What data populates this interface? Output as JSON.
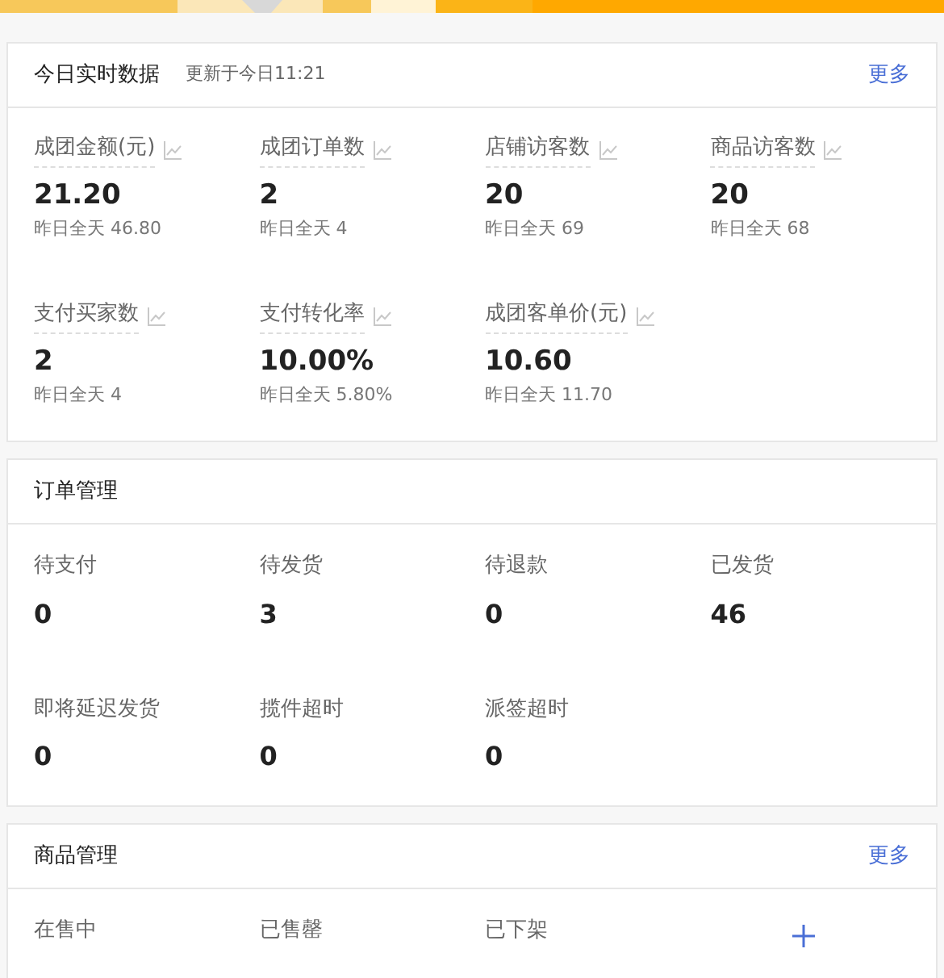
{
  "realtime": {
    "title": "今日实时数据",
    "updated": "更新于今日11:21",
    "more": "更多",
    "metrics": [
      {
        "label": "成团金额(元)",
        "value": "21.20",
        "yesterday": "昨日全天 46.80"
      },
      {
        "label": "成团订单数",
        "value": "2",
        "yesterday": "昨日全天 4"
      },
      {
        "label": "店铺访客数",
        "value": "20",
        "yesterday": "昨日全天 69"
      },
      {
        "label": "商品访客数",
        "value": "20",
        "yesterday": "昨日全天 68"
      },
      {
        "label": "支付买家数",
        "value": "2",
        "yesterday": "昨日全天 4"
      },
      {
        "label": "支付转化率",
        "value": "10.00%",
        "yesterday": "昨日全天 5.80%"
      },
      {
        "label": "成团客单价(元)",
        "value": "10.60",
        "yesterday": "昨日全天 11.70"
      }
    ]
  },
  "orders": {
    "title": "订单管理",
    "items": [
      {
        "label": "待支付",
        "value": "0"
      },
      {
        "label": "待发货",
        "value": "3"
      },
      {
        "label": "待退款",
        "value": "0"
      },
      {
        "label": "已发货",
        "value": "46"
      },
      {
        "label": "即将延迟发货",
        "value": "0"
      },
      {
        "label": "揽件超时",
        "value": "0"
      },
      {
        "label": "派签超时",
        "value": "0"
      }
    ]
  },
  "goods": {
    "title": "商品管理",
    "more": "更多",
    "items": [
      {
        "label": "在售中"
      },
      {
        "label": "已售罄"
      },
      {
        "label": "已下架"
      }
    ]
  }
}
